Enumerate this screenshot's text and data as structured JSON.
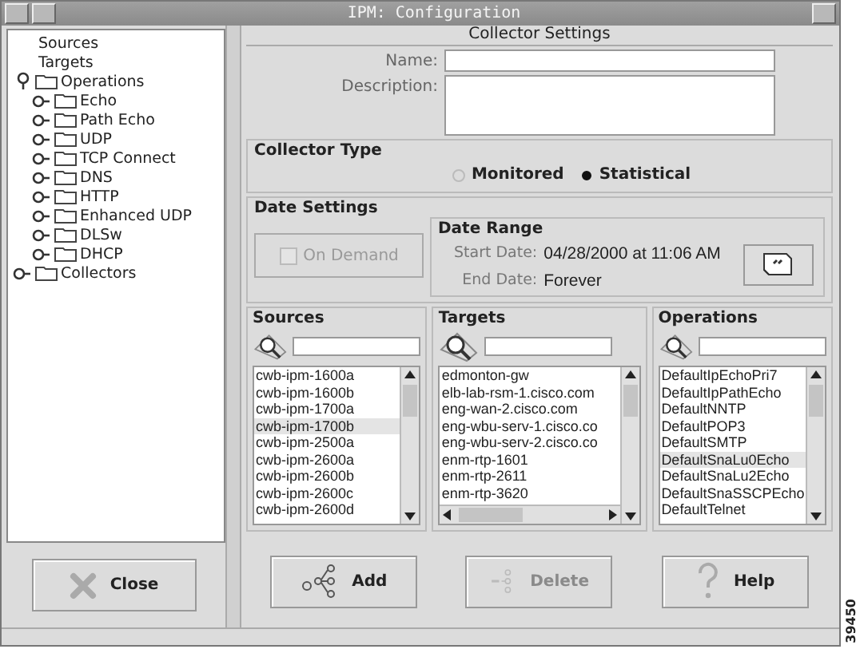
{
  "window": {
    "title": "IPM: Configuration"
  },
  "tree": {
    "items": [
      {
        "label": "Sources"
      },
      {
        "label": "Targets"
      },
      {
        "label": "Operations",
        "expanded": true,
        "children": [
          {
            "label": "Echo",
            "expanded": false
          },
          {
            "label": "Path Echo",
            "expanded": false
          },
          {
            "label": "UDP",
            "expanded": false
          },
          {
            "label": "TCP Connect",
            "expanded": false
          },
          {
            "label": "DNS",
            "expanded": false
          },
          {
            "label": "HTTP",
            "expanded": false
          },
          {
            "label": "Enhanced UDP",
            "expanded": false
          },
          {
            "label": "DLSw",
            "expanded": false
          },
          {
            "label": "DHCP",
            "expanded": false
          }
        ]
      },
      {
        "label": "Collectors",
        "expanded": false
      }
    ]
  },
  "settings": {
    "title": "Collector Settings",
    "name_label": "Name:",
    "description_label": "Description:"
  },
  "collector_type": {
    "title": "Collector Type",
    "options": [
      {
        "label": "Monitored",
        "selected": false
      },
      {
        "label": "Statistical",
        "selected": true
      }
    ]
  },
  "date_settings": {
    "title": "Date Settings",
    "on_demand": {
      "label": "On Demand",
      "checked": false,
      "disabled": true
    },
    "date_range": {
      "title": "Date Range",
      "start_label": "Start Date:",
      "start_value": "04/28/2000 at 11:06 AM",
      "end_label": "End Date:",
      "end_value": "Forever"
    }
  },
  "lists": [
    {
      "title": "Sources",
      "hscroll": false,
      "items": [
        {
          "label": "cwb-ipm-1600a",
          "selected": false
        },
        {
          "label": "cwb-ipm-1600b",
          "selected": false
        },
        {
          "label": "cwb-ipm-1700a",
          "selected": false
        },
        {
          "label": "cwb-ipm-1700b",
          "selected": true
        },
        {
          "label": "cwb-ipm-2500a",
          "selected": false
        },
        {
          "label": "cwb-ipm-2600a",
          "selected": false
        },
        {
          "label": "cwb-ipm-2600b",
          "selected": false
        },
        {
          "label": "cwb-ipm-2600c",
          "selected": false
        },
        {
          "label": "cwb-ipm-2600d",
          "selected": false
        }
      ]
    },
    {
      "title": "Targets",
      "hscroll": true,
      "items": [
        {
          "label": "edmonton-gw",
          "selected": false
        },
        {
          "label": "elb-lab-rsm-1.cisco.com",
          "selected": false
        },
        {
          "label": "eng-wan-2.cisco.com",
          "selected": false
        },
        {
          "label": "eng-wbu-serv-1.cisco.co",
          "selected": false
        },
        {
          "label": "eng-wbu-serv-2.cisco.co",
          "selected": false
        },
        {
          "label": "enm-rtp-1601",
          "selected": false
        },
        {
          "label": "enm-rtp-2611",
          "selected": false
        },
        {
          "label": "enm-rtp-3620",
          "selected": false
        }
      ]
    },
    {
      "title": "Operations",
      "hscroll": false,
      "items": [
        {
          "label": "DefaultIpEchoPri7",
          "selected": false
        },
        {
          "label": "DefaultIpPathEcho",
          "selected": false
        },
        {
          "label": "DefaultNNTP",
          "selected": false
        },
        {
          "label": "DefaultPOP3",
          "selected": false
        },
        {
          "label": "DefaultSMTP",
          "selected": false
        },
        {
          "label": "DefaultSnaLu0Echo",
          "selected": true
        },
        {
          "label": "DefaultSnaLu2Echo",
          "selected": false
        },
        {
          "label": "DefaultSnaSSCPEcho",
          "selected": false
        },
        {
          "label": "DefaultTelnet",
          "selected": false
        }
      ]
    }
  ],
  "buttons": [
    {
      "kind": "close",
      "label": "Close",
      "disabled": false
    },
    {
      "kind": "add",
      "label": "Add",
      "disabled": false
    },
    {
      "kind": "delete",
      "label": "Delete",
      "disabled": true
    },
    {
      "kind": "help",
      "label": "Help",
      "disabled": false
    }
  ],
  "figure_number": "39450"
}
